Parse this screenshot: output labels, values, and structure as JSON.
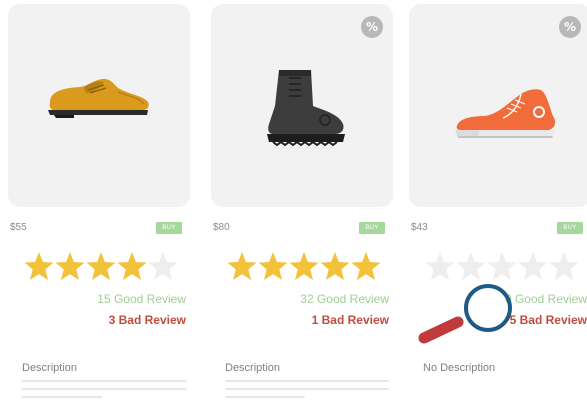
{
  "colors": {
    "star_filled": "#f3c23b",
    "star_empty": "#eeeeee",
    "good_review": "#9fcf95",
    "bad_review": "#c24b3d",
    "buy_button": "#a6d79c",
    "image_panel": "#f2f2f2",
    "magnifier_ring": "#1f5a86",
    "magnifier_handle": "#c0393b"
  },
  "products": [
    {
      "image_icon": "brown-oxford-shoe-icon",
      "discount_badge": "",
      "price": "$55",
      "buy_label": "BUY",
      "rating": 4,
      "max_rating": 5,
      "good_review": "15 Good Review",
      "bad_review": "3 Bad Review",
      "description_label": "Description"
    },
    {
      "image_icon": "black-boot-icon",
      "discount_badge": "%",
      "price": "$80",
      "buy_label": "BUY",
      "rating": 5,
      "max_rating": 5,
      "good_review": "32 Good Review",
      "bad_review": "1 Bad Review",
      "description_label": "Description"
    },
    {
      "image_icon": "red-sneaker-icon",
      "discount_badge": "%",
      "price": "$43",
      "buy_label": "BUY",
      "rating": 0,
      "max_rating": 5,
      "good_review": "0 Good Review",
      "bad_review": "5 Bad Review",
      "description_label": "No Description"
    }
  ],
  "overlay": {
    "icon": "magnifying-glass-icon"
  }
}
